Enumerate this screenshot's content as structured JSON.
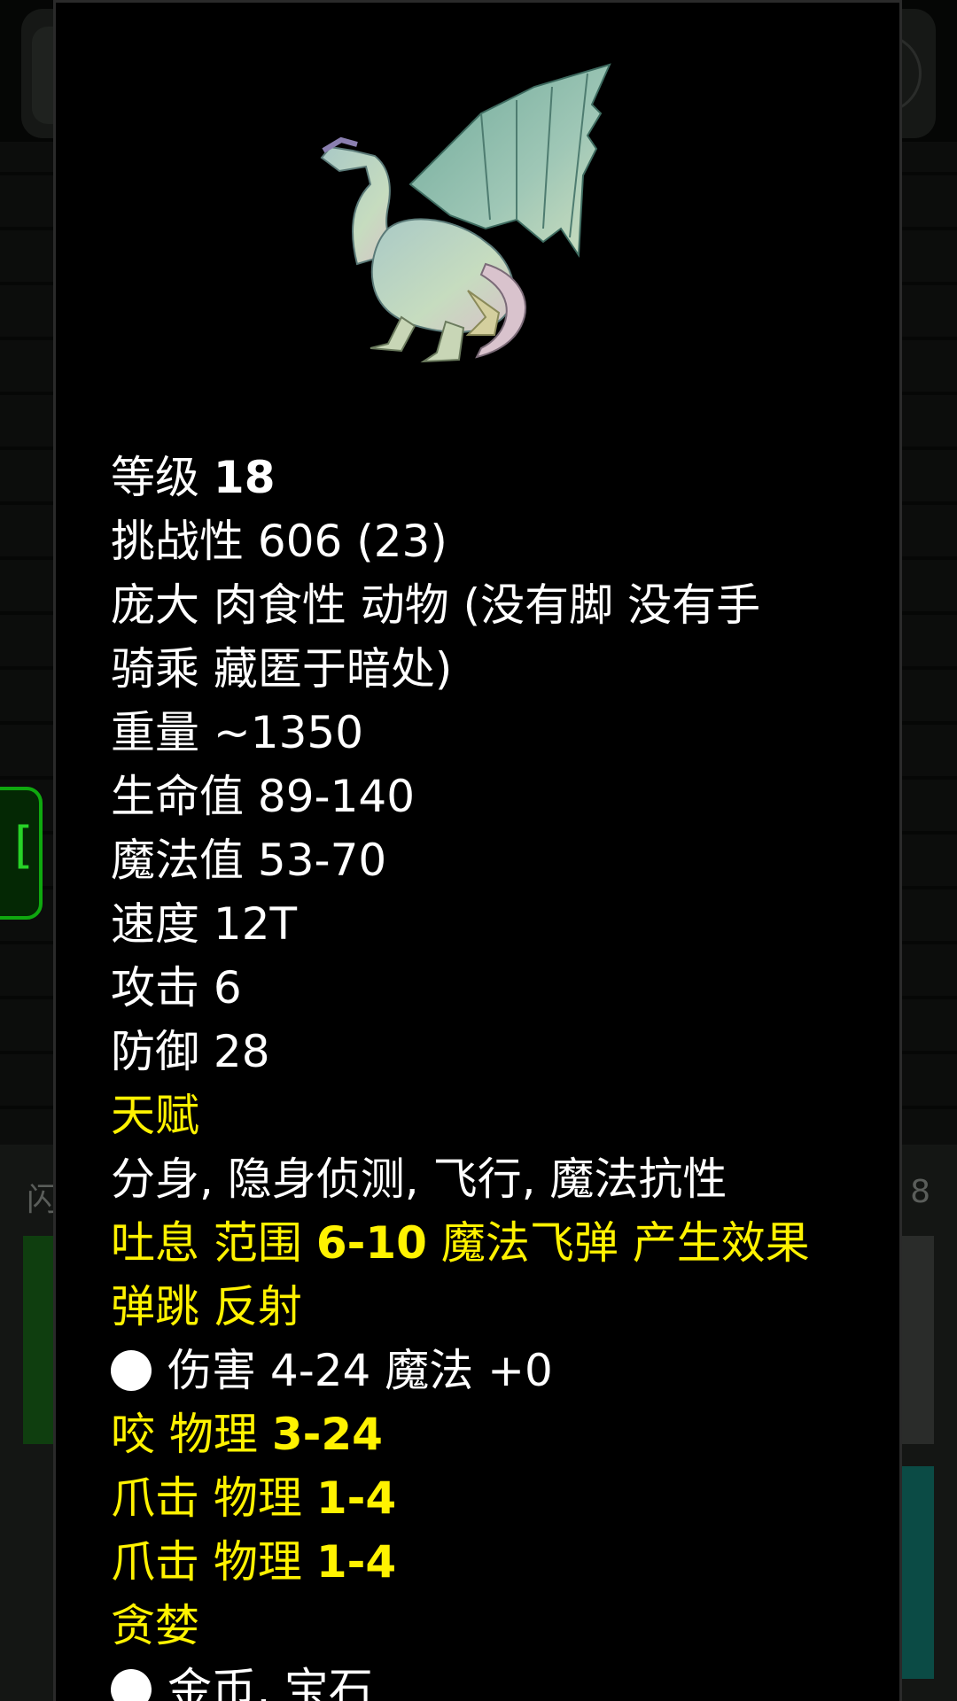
{
  "monster": {
    "level_label": "等级",
    "level_value": "18",
    "challenge_label": "挑战性",
    "challenge_value": "606 (23)",
    "traits_line1": "庞大 肉食性 动物 (没有脚 没有手",
    "traits_line2": "骑乘 藏匿于暗处)",
    "weight_label": "重量",
    "weight_value": "~1350",
    "hp_label": "生命值",
    "hp_value": "89-140",
    "mp_label": "魔法值",
    "mp_value": "53-70",
    "speed_label": "速度",
    "speed_value": "12T",
    "attack_label": "攻击",
    "attack_value": "6",
    "defense_label": "防御",
    "defense_value": "28",
    "talent_header": "天赋",
    "talents": "分身, 隐身侦测, 飞行, 魔法抗性",
    "breath_prefix": "吐息 范围",
    "breath_range": "6-10",
    "breath_suffix": "魔法飞弹 产生效果",
    "breath_line2": "弹跳 反射",
    "breath_damage": "伤害 4-24 魔法 +0",
    "bite_label": "咬 物理",
    "bite_value": "3-24",
    "claw1_label": "爪击 物理",
    "claw1_value": "1-4",
    "claw2_label": "爪击 物理",
    "claw2_value": "1-4",
    "greed_header": "贪婪",
    "greed_items": "金币, 宝石"
  },
  "background": {
    "green_chip_glyph": "[",
    "bottom_left_text": "闪",
    "bottom_right_text": "8"
  },
  "colors": {
    "highlight": "#fff200",
    "text": "#ffffff",
    "dialog_bg": "#000000"
  },
  "icons": {
    "portrait": "dragon-portrait-icon",
    "bullet": "white-dot-icon"
  }
}
